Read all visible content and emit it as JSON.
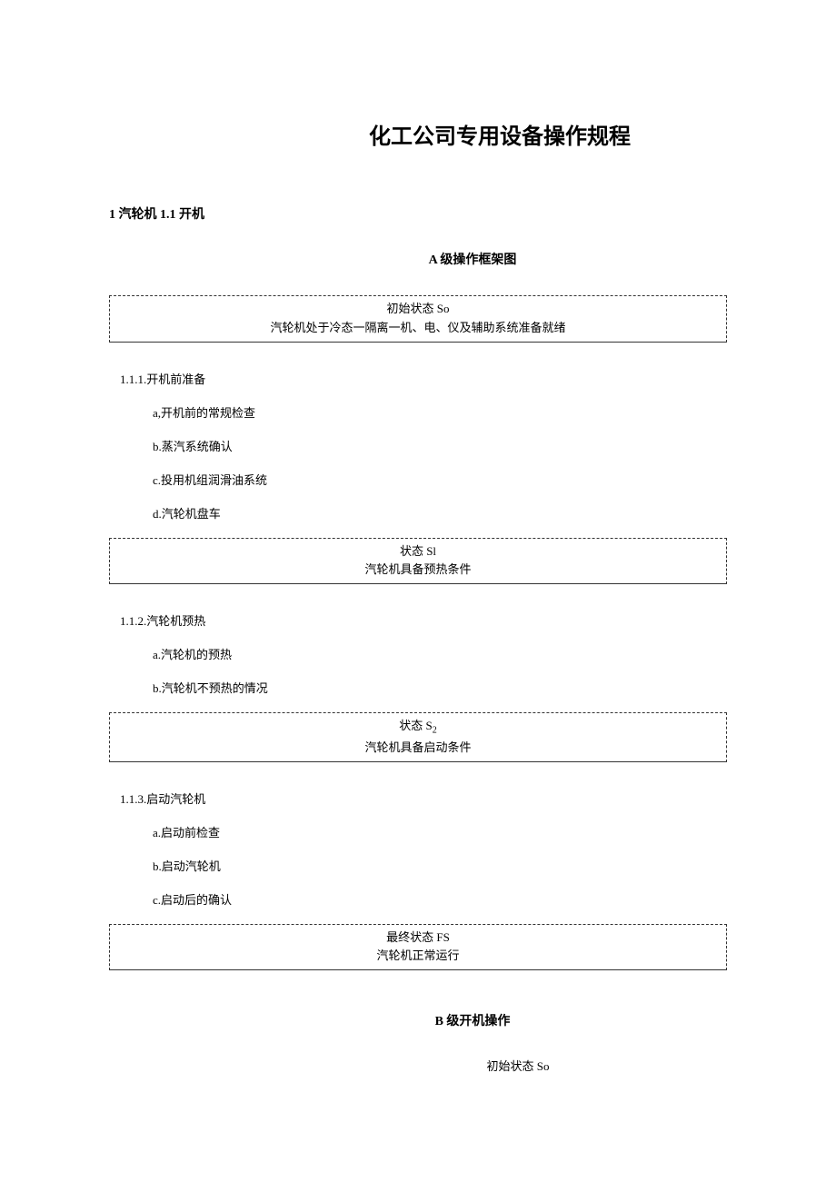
{
  "title": "化工公司专用设备操作规程",
  "section_header": "1 汽轮机 1.1 开机",
  "subtitle_a": "A 级操作框架图",
  "box0": {
    "line1": "初始状态 So",
    "line2": "汽轮机处于冷态一隔离一机、电、仪及辅助系统准备就绪"
  },
  "sec1": {
    "num": "1.1.1.开机前准备",
    "a": "a,开机前的常规检查",
    "b": "b.蒸汽系统确认",
    "c": "c.投用机组润滑油系统",
    "d": "d.汽轮机盘车"
  },
  "box1": {
    "line1": "状态 Sl",
    "line2": "汽轮机具备预热条件"
  },
  "sec2": {
    "num": "1.1.2.汽轮机预热",
    "a": "a.汽轮机的预热",
    "b": "b.汽轮机不预热的情况"
  },
  "box2": {
    "line1_prefix": "状态 S",
    "line1_sub": "2",
    "line2": "汽轮机具备启动条件"
  },
  "sec3": {
    "num": "1.1.3.启动汽轮机",
    "a": "a.启动前检查",
    "b": "b.启动汽轮机",
    "c": "c.启动后的确认"
  },
  "box3": {
    "line1": "最终状态 FS",
    "line2": "汽轮机正常运行"
  },
  "subtitle_b": "B 级开机操作",
  "footer": "初始状态 So"
}
